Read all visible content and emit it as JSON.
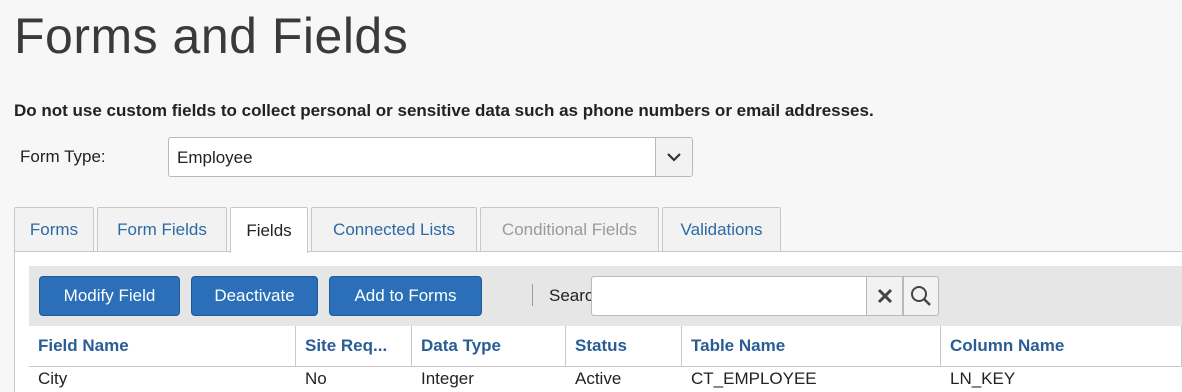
{
  "page": {
    "title": "Forms and Fields",
    "warning": "Do not use custom fields to collect personal or sensitive data such as phone numbers or email addresses."
  },
  "form_type": {
    "label": "Form Type:",
    "selected": "Employee",
    "dropdown_icon": "chevron-down-icon"
  },
  "tabs": [
    {
      "label": "Forms",
      "state": "normal"
    },
    {
      "label": "Form Fields",
      "state": "normal"
    },
    {
      "label": "Fields",
      "state": "active"
    },
    {
      "label": "Connected Lists",
      "state": "normal"
    },
    {
      "label": "Conditional Fields",
      "state": "disabled"
    },
    {
      "label": "Validations",
      "state": "normal"
    }
  ],
  "toolbar": {
    "modify_label": "Modify Field",
    "deactivate_label": "Deactivate",
    "add_to_forms_label": "Add to Forms",
    "separator": "|",
    "search_label": "Search:",
    "search_value": "",
    "clear_icon": "close-icon",
    "search_icon": "search-icon"
  },
  "table": {
    "columns": [
      "Field Name",
      "Site Req...",
      "Data Type",
      "Status",
      "Table Name",
      "Column Name"
    ],
    "rows": [
      [
        "City",
        "No",
        "Integer",
        "Active",
        "CT_EMPLOYEE",
        "LN_KEY"
      ]
    ]
  },
  "colors": {
    "primary_button": "#2a6fb7",
    "link_text": "#2c6aa6",
    "header_text": "#2a5d95",
    "disabled_text": "#9a9a9a"
  }
}
